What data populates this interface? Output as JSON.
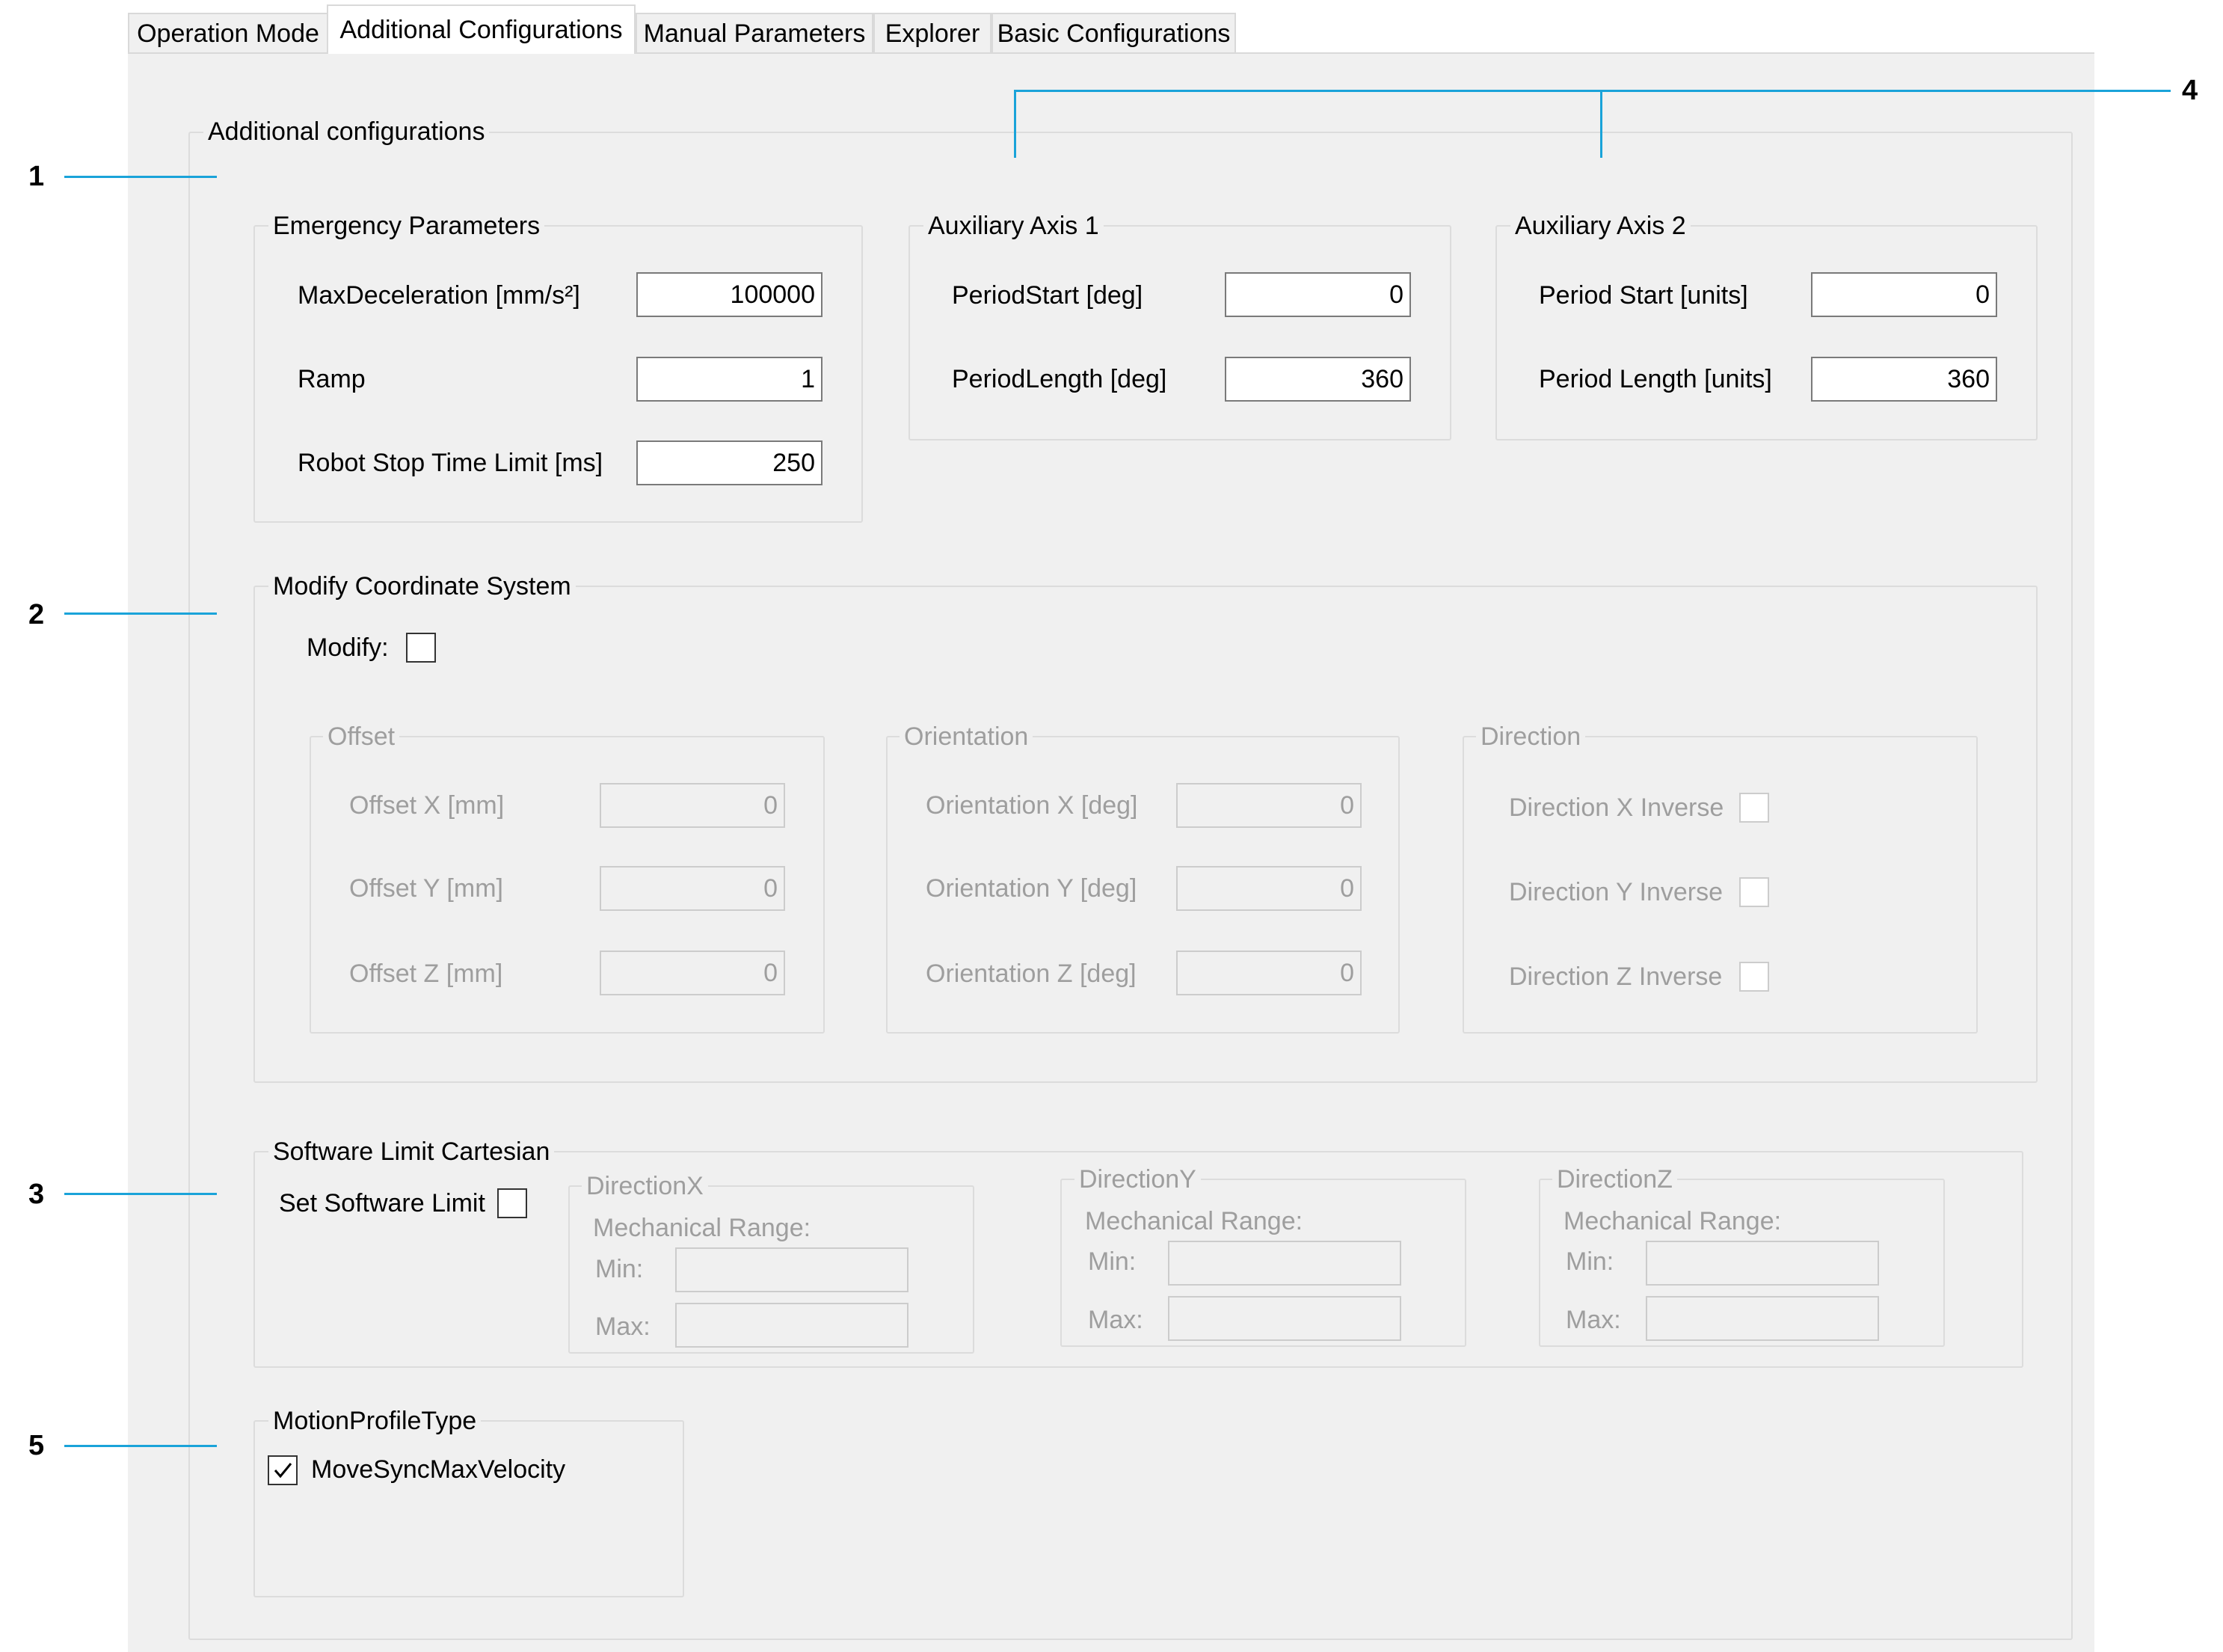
{
  "tabs": [
    {
      "label": "Operation Mode",
      "active": false
    },
    {
      "label": "Additional Configurations",
      "active": true
    },
    {
      "label": "Manual Parameters",
      "active": false
    },
    {
      "label": "Explorer",
      "active": false
    },
    {
      "label": "Basic Configurations",
      "active": false
    }
  ],
  "main_group": {
    "title": "Additional configurations"
  },
  "emergency": {
    "title": "Emergency Parameters",
    "max_deceleration_label": "MaxDeceleration [mm/s²]",
    "max_deceleration_value": "100000",
    "ramp_label": "Ramp",
    "ramp_value": "1",
    "robot_stop_label": "Robot Stop Time Limit [ms]",
    "robot_stop_value": "250"
  },
  "aux1": {
    "title": "Auxiliary Axis 1",
    "period_start_label": "PeriodStart [deg]",
    "period_start_value": "0",
    "period_length_label": "PeriodLength [deg]",
    "period_length_value": "360"
  },
  "aux2": {
    "title": "Auxiliary Axis 2",
    "period_start_label": "Period Start [units]",
    "period_start_value": "0",
    "period_length_label": "Period Length [units]",
    "period_length_value": "360"
  },
  "modify_cs": {
    "title": "Modify Coordinate System",
    "modify_label": "Modify:",
    "modify_checked": false,
    "offset": {
      "title": "Offset",
      "x_label": "Offset X [mm]",
      "x_value": "0",
      "y_label": "Offset Y [mm]",
      "y_value": "0",
      "z_label": "Offset Z [mm]",
      "z_value": "0"
    },
    "orientation": {
      "title": "Orientation",
      "x_label": "Orientation X [deg]",
      "x_value": "0",
      "y_label": "Orientation Y [deg]",
      "y_value": "0",
      "z_label": "Orientation Z [deg]",
      "z_value": "0"
    },
    "direction": {
      "title": "Direction",
      "x_label": "Direction X Inverse",
      "y_label": "Direction Y Inverse",
      "z_label": "Direction Z Inverse"
    }
  },
  "software_limit": {
    "title": "Software Limit Cartesian",
    "set_label": "Set Software Limit",
    "set_checked": false,
    "mech_range_label": "Mechanical Range:",
    "min_label": "Min:",
    "max_label": "Max:",
    "dir_x_title": "DirectionX",
    "dir_y_title": "DirectionY",
    "dir_z_title": "DirectionZ"
  },
  "motion_profile": {
    "title": "MotionProfileType",
    "option_label": "MoveSyncMaxVelocity",
    "option_checked": true
  },
  "callouts": [
    "1",
    "2",
    "3",
    "4",
    "5"
  ],
  "colors": {
    "callout": "#1aa3d9",
    "panel": "#f0f0f0"
  }
}
